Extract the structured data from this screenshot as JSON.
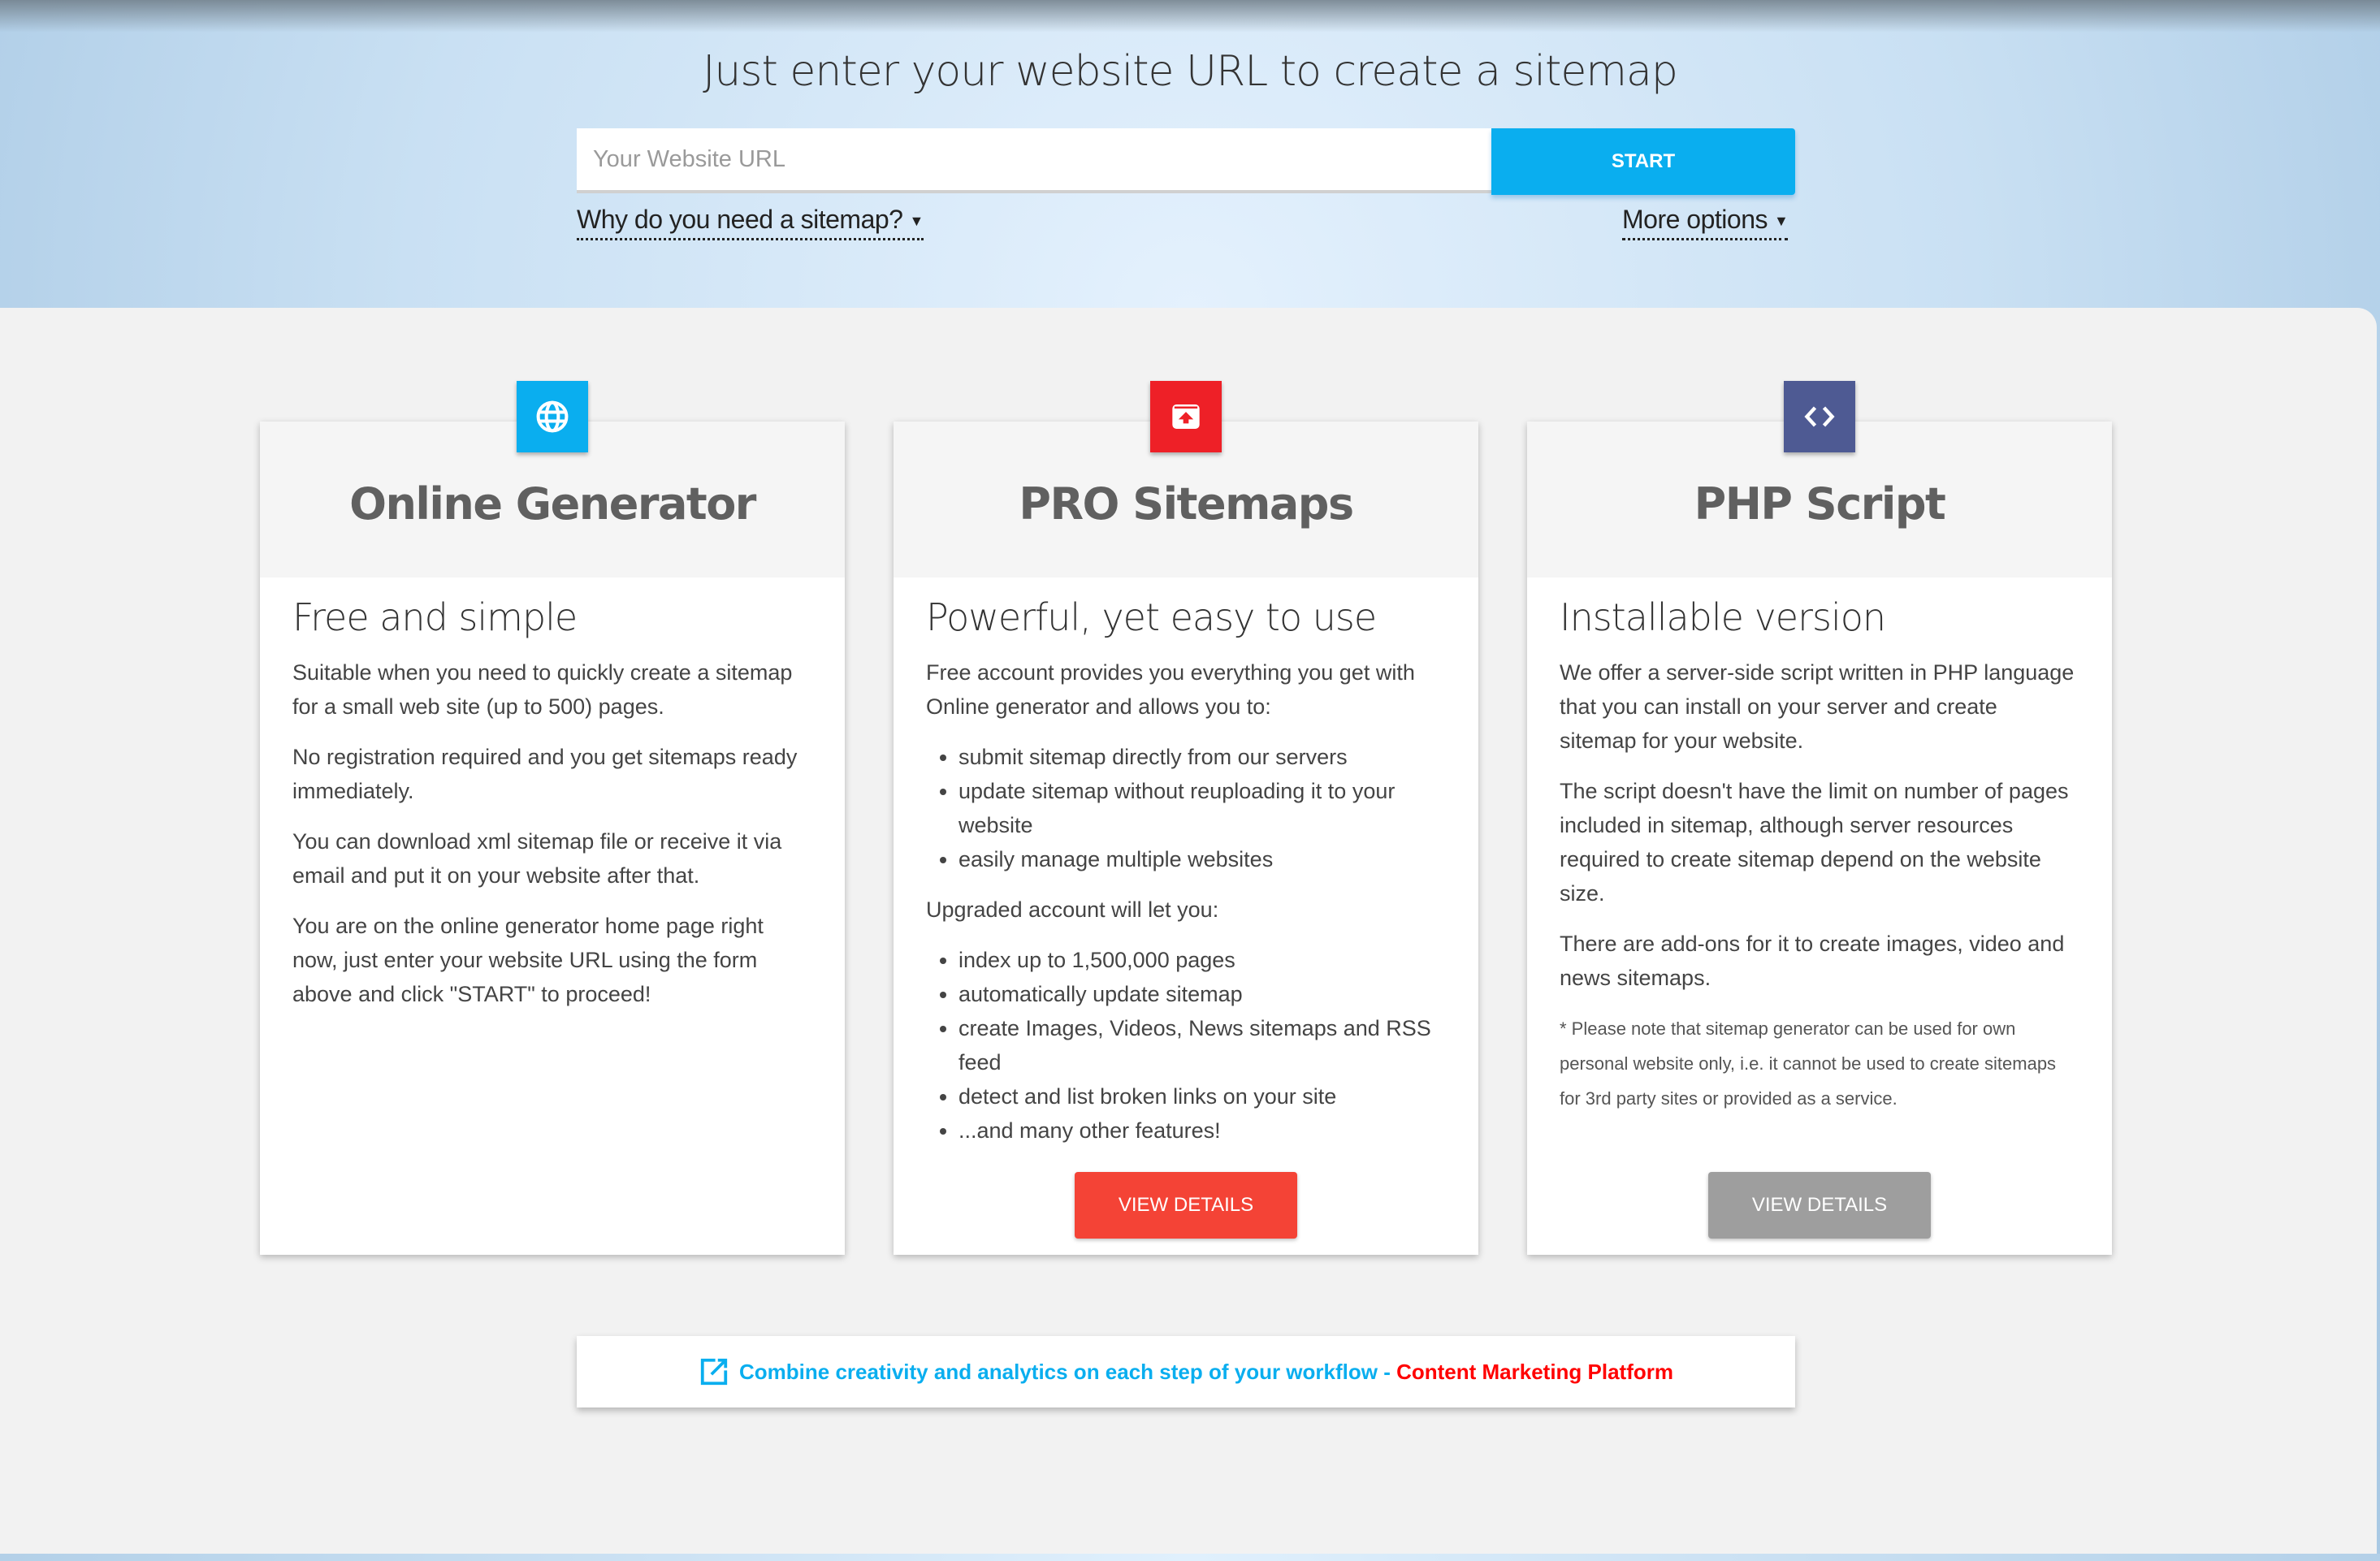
{
  "hero": {
    "title": "Just enter your website URL to create a sitemap",
    "url_placeholder": "Your Website URL",
    "url_value": "",
    "start_label": "START",
    "why_link": "Why do you need a sitemap?",
    "more_link": "More options"
  },
  "colors": {
    "accent_blue": "#0aaeef",
    "pro_red": "#ee2027",
    "php_indigo": "#4e5a93",
    "view_red": "#f44336",
    "view_gray": "#9e9e9e"
  },
  "cards": [
    {
      "icon": "globe-icon",
      "title": "Online Generator",
      "subtitle": "Free and simple",
      "paragraphs": [
        "Suitable when you need to quickly create a sitemap for a small web site (up to 500) pages.",
        "No registration required and you get sitemaps ready immediately.",
        "You can download xml sitemap file or receive it via email and put it on your website after that.",
        "You are on the online generator home page right now, just enter your website URL using the form above and click \"START\" to proceed!"
      ]
    },
    {
      "icon": "upload-box-icon",
      "title": "PRO Sitemaps",
      "subtitle": "Powerful, yet easy to use",
      "intro": "Free account provides you everything you get with Online generator and allows you to:",
      "free_features": [
        "submit sitemap directly from our servers",
        "update sitemap without reuploading it to your website",
        "easily manage multiple websites"
      ],
      "upgraded_intro": "Upgraded account will let you:",
      "upgraded_features": [
        "index up to 1,500,000 pages",
        "automatically update sitemap",
        "create Images, Videos, News sitemaps and RSS feed",
        "detect and list broken links on your site",
        "...and many other features!"
      ],
      "button": "VIEW DETAILS"
    },
    {
      "icon": "code-icon",
      "title": "PHP Script",
      "subtitle": "Installable version",
      "paragraphs": [
        "We offer a server-side script written in PHP language that you can install on your server and create sitemap for your website.",
        "The script doesn't have the limit on number of pages included in sitemap, although server resources required to create sitemap depend on the website size.",
        "There are add-ons for it to create images, video and news sitemaps."
      ],
      "note": "* Please note that sitemap generator can be used for own personal website only, i.e. it cannot be used to create sitemaps for 3rd party sites or provided as a service.",
      "button": "VIEW DETAILS"
    }
  ],
  "promo": {
    "icon": "external-link-icon",
    "text": "Combine creativity and analytics on each step of your workflow - ",
    "link": "Content Marketing Platform"
  }
}
